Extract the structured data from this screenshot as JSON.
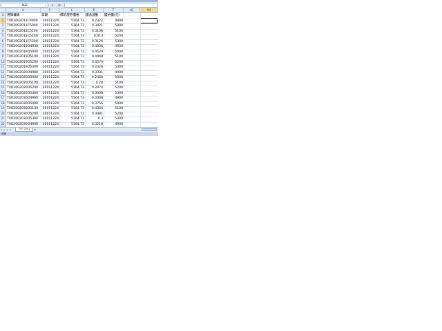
{
  "formula_bar": {
    "name_box": "AH2",
    "name_box_arrow_icon": "▾",
    "cancel_icon": "×",
    "fx_label": "fx",
    "formula": ""
  },
  "columns": [
    {
      "id": "col-a",
      "label": "A"
    },
    {
      "id": "col-c",
      "label": "C"
    },
    {
      "id": "col-l",
      "label": "L"
    },
    {
      "id": "col-p",
      "label": "P"
    },
    {
      "id": "col-t",
      "label": "T"
    },
    {
      "id": "col-ag",
      "label": "AG"
    },
    {
      "id": "col-ah",
      "label": "AH"
    }
  ],
  "rows": [
    {
      "n": "1",
      "a": "選擇權碼",
      "c": "日期",
      "l": "標的證券價格",
      "p": "隱含波動",
      "t": "履約價(元)"
    },
    {
      "n": "2",
      "a": "TXO2002011C4900",
      "c": "20011224",
      "l": "5164.73",
      "p": "0.2372",
      "t": "4900"
    },
    {
      "n": "3",
      "a": "TXO2002011C5000",
      "c": "20011224",
      "l": "5164.73",
      "p": "0.3421",
      "t": "5000"
    },
    {
      "n": "4",
      "a": "TXO2002011C5100",
      "c": "20011224",
      "l": "5164.73",
      "p": "0.3106",
      "t": "5100"
    },
    {
      "n": "5",
      "a": "TXO2002011C5200",
      "c": "20011224",
      "l": "5164.73",
      "p": "0.313",
      "t": "5200"
    },
    {
      "n": "6",
      "a": "TXO2002011C5300",
      "c": "20011224",
      "l": "5164.73",
      "p": "0.3126",
      "t": "5300"
    },
    {
      "n": "7",
      "a": "TXO2002019O4900",
      "c": "20011224",
      "l": "5164.73",
      "p": "0.4036",
      "t": "4900"
    },
    {
      "n": "8",
      "a": "TXO2002019O5000",
      "c": "20011224",
      "l": "5164.73",
      "p": "0.4529",
      "t": "5000"
    },
    {
      "n": "9",
      "a": "TXO2002019O5100",
      "c": "20011224",
      "l": "5164.73",
      "p": "0.4448",
      "t": "5100"
    },
    {
      "n": "10",
      "a": "TXO2002019O5200",
      "c": "20011224",
      "l": "5164.73",
      "p": "0.3579",
      "t": "5200"
    },
    {
      "n": "11",
      "a": "TXO2002019O5300",
      "c": "20011224",
      "l": "5164.73",
      "p": "0.2426",
      "t": "5300"
    },
    {
      "n": "12",
      "a": "TXO2002020O4900",
      "c": "20011224",
      "l": "5164.73",
      "p": "0.3331",
      "t": "4900"
    },
    {
      "n": "13",
      "a": "TXO2002020O5000",
      "c": "20011224",
      "l": "5164.73",
      "p": "0.2458",
      "t": "5000"
    },
    {
      "n": "14",
      "a": "TXO2002020O5100",
      "c": "20011224",
      "l": "5164.73",
      "p": "0.28",
      "t": "5100"
    },
    {
      "n": "15",
      "a": "TXO2002020O5200",
      "c": "20011224",
      "l": "5164.73",
      "p": "0.2974",
      "t": "5200"
    },
    {
      "n": "16",
      "a": "TXO2002020O5300",
      "c": "20011224",
      "l": "5164.73",
      "p": "0.3008",
      "t": "5300"
    },
    {
      "n": "17",
      "a": "TXO2002030O4900",
      "c": "20011224",
      "l": "5164.73",
      "p": "0.3368",
      "t": "4900"
    },
    {
      "n": "18",
      "a": "TXO2002030O5000",
      "c": "20011224",
      "l": "5164.73",
      "p": "0.3756",
      "t": "5000"
    },
    {
      "n": "19",
      "a": "TXO2002030O5100",
      "c": "20011224",
      "l": "5164.73",
      "p": "0.4354",
      "t": "5100"
    },
    {
      "n": "20",
      "a": "TXO2002030O5200",
      "c": "20011224",
      "l": "5164.73",
      "p": "0.3481",
      "t": "5200"
    },
    {
      "n": "21",
      "a": "TXO2002030O5300",
      "c": "20011224",
      "l": "5164.73",
      "p": "0.3",
      "t": "5300"
    },
    {
      "n": "22",
      "a": "TXO2002030O4900",
      "c": "20011224",
      "l": "5164.73",
      "p": "0.3218",
      "t": "4900"
    }
  ],
  "sheet_tabs": {
    "nav_first_icon": "◂",
    "nav_prev_icon": "◂",
    "nav_next_icon": "▸",
    "nav_last_icon": "▸",
    "active_tab": "TXO 2001",
    "new_sheet_icon": "⊞"
  },
  "status": {
    "text": "就緒"
  },
  "colors": {
    "header_bg": "#e3ebf6",
    "active_header_bg": "#f9d78a",
    "gridline": "#dde3ec"
  }
}
